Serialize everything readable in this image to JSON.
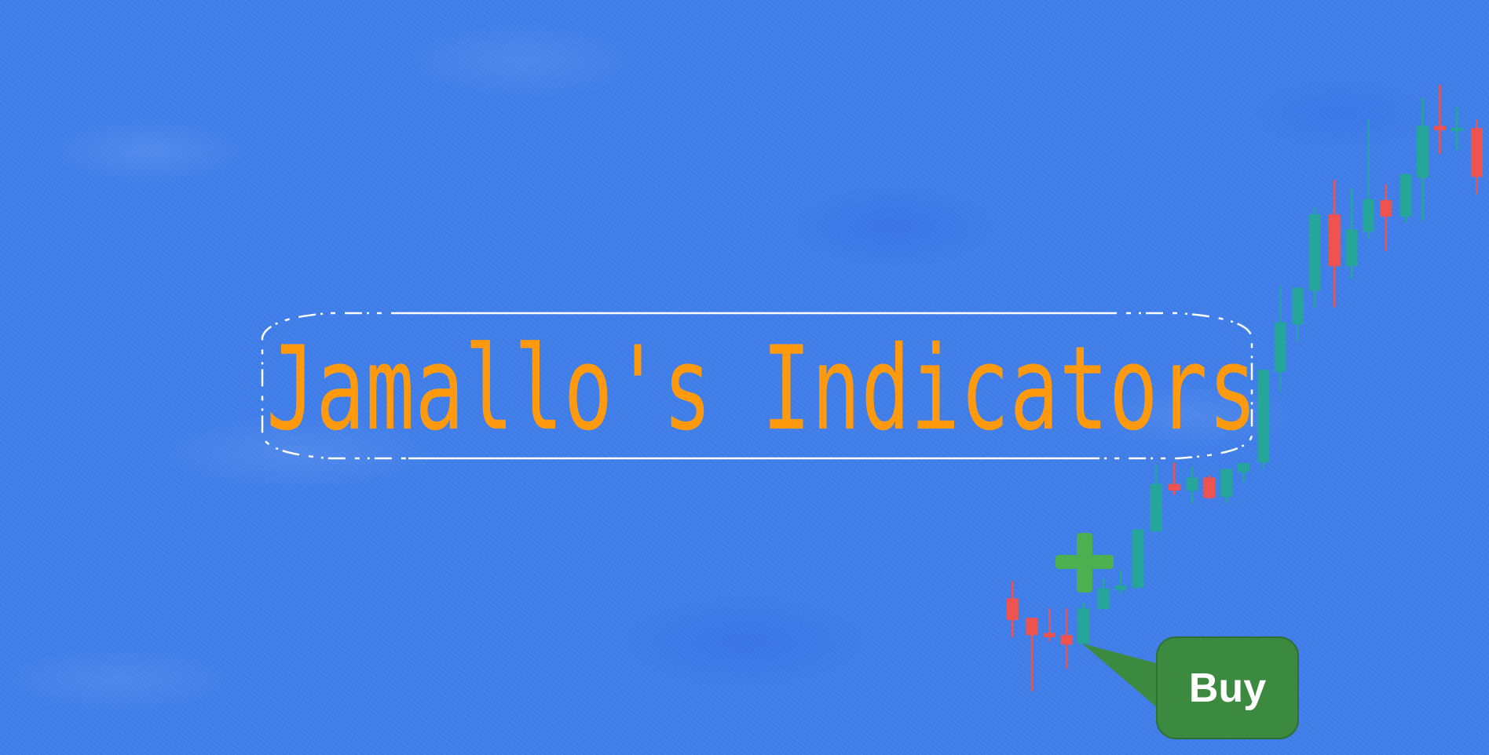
{
  "banner": {
    "title": "Jamallo's Indicators",
    "signal_label": "Buy",
    "signal_icon": "plus-icon"
  },
  "colors": {
    "background": "#3f7ee9",
    "title": "#ff9a0e",
    "bull_candle": "#26a69a",
    "bear_candle": "#ef5350",
    "signal_plus": "#4caf50",
    "bubble": "#3c8a3f",
    "frame": "#ffffff"
  }
}
